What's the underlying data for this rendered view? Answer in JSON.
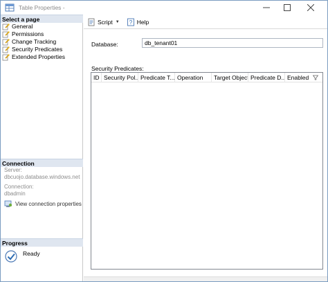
{
  "window": {
    "title": "Table Properties -"
  },
  "left_pane": {
    "select_page_header": "Select a page",
    "pages": [
      {
        "label": "General"
      },
      {
        "label": "Permissions"
      },
      {
        "label": "Change Tracking"
      },
      {
        "label": "Security Predicates"
      },
      {
        "label": "Extended Properties"
      }
    ],
    "connection_header": "Connection",
    "server_label": "Server:",
    "server_value": "dbcuojo.database.windows.net",
    "connection_label": "Connection:",
    "connection_value": "dbadmin",
    "view_connection_link": "View connection properties",
    "progress_header": "Progress",
    "progress_status": "Ready"
  },
  "toolbar": {
    "script_label": "Script",
    "help_label": "Help"
  },
  "main": {
    "database_label": "Database:",
    "database_value": "db_tenant01",
    "security_predicates_label": "Security Predicates:",
    "grid_columns": [
      "ID",
      "Security Pol...",
      "Predicate T...",
      "Operation",
      "Target Object",
      "Predicate D...",
      "Enabled"
    ]
  }
}
